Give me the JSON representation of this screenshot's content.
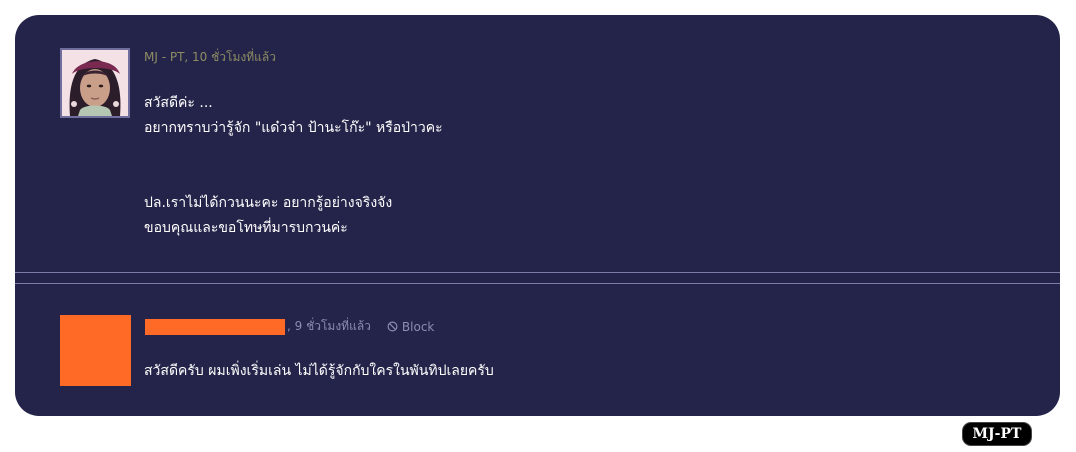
{
  "comments": [
    {
      "author": "MJ - PT",
      "time": ", 10 ชั่วโมงที่แล้ว",
      "body": [
        "สวัสดีค่ะ ...",
        "อยากทราบว่ารู้จัก \"แด๋วจ๋า  ป้านะโก๊ะ\" หรือป่าวคะ",
        "",
        "",
        "ปล.เราไม่ได้กวนนะคะ อยากรู้อย่างจริงจัง",
        "ขอบคุณและขอโทษที่มารบกวนค่ะ"
      ]
    },
    {
      "time": ", 9 ชั่วโมงที่แล้ว",
      "block_label": "Block",
      "body": [
        "สวัสดีครับ  ผมเพิ่งเริ่มเล่น ไม่ได้รู้จักกับใครในพันทิปเลยครับ"
      ]
    }
  ],
  "watermark": "MJ-PT",
  "colors": {
    "panel": "#24244a",
    "divider": "#7d7ca8",
    "redaction": "#ff6a26",
    "author_meta": "#8d8c63"
  },
  "icons": {
    "block": "block-icon"
  }
}
